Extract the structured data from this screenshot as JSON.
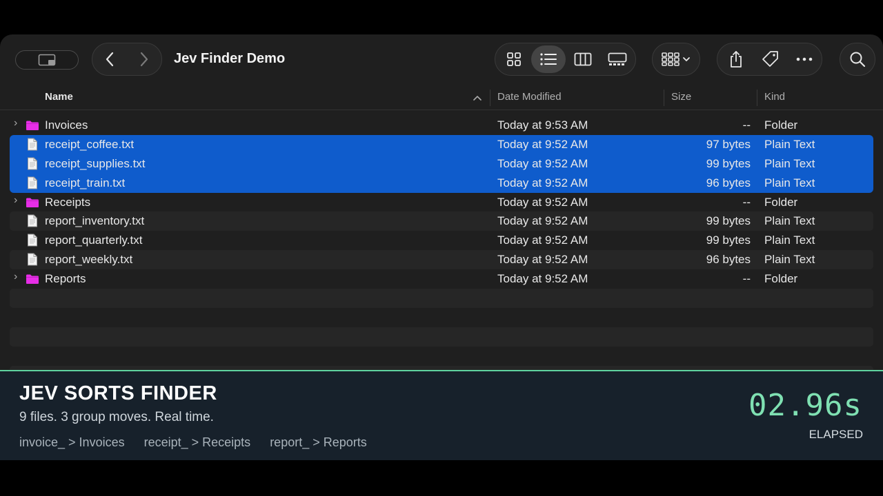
{
  "window": {
    "title": "Jev Finder Demo"
  },
  "columns": {
    "name": "Name",
    "date": "Date Modified",
    "size": "Size",
    "kind": "Kind"
  },
  "files": [
    {
      "name": "Invoices",
      "date": "Today at 9:53 AM",
      "size": "--",
      "kind": "Folder",
      "type": "folder",
      "selected": false
    },
    {
      "name": "receipt_coffee.txt",
      "date": "Today at 9:52 AM",
      "size": "97 bytes",
      "kind": "Plain Text",
      "type": "file",
      "selected": true
    },
    {
      "name": "receipt_supplies.txt",
      "date": "Today at 9:52 AM",
      "size": "99 bytes",
      "kind": "Plain Text",
      "type": "file",
      "selected": true
    },
    {
      "name": "receipt_train.txt",
      "date": "Today at 9:52 AM",
      "size": "96 bytes",
      "kind": "Plain Text",
      "type": "file",
      "selected": true
    },
    {
      "name": "Receipts",
      "date": "Today at 9:52 AM",
      "size": "--",
      "kind": "Folder",
      "type": "folder",
      "selected": false
    },
    {
      "name": "report_inventory.txt",
      "date": "Today at 9:52 AM",
      "size": "99 bytes",
      "kind": "Plain Text",
      "type": "file",
      "selected": false
    },
    {
      "name": "report_quarterly.txt",
      "date": "Today at 9:52 AM",
      "size": "99 bytes",
      "kind": "Plain Text",
      "type": "file",
      "selected": false
    },
    {
      "name": "report_weekly.txt",
      "date": "Today at 9:52 AM",
      "size": "96 bytes",
      "kind": "Plain Text",
      "type": "file",
      "selected": false
    },
    {
      "name": "Reports",
      "date": "Today at 9:52 AM",
      "size": "--",
      "kind": "Folder",
      "type": "folder",
      "selected": false
    }
  ],
  "overlay": {
    "title": "JEV SORTS FINDER",
    "subtitle": "9 files. 3 group moves. Real time.",
    "rules": [
      "invoice_ > Invoices",
      "receipt_ > Receipts",
      "report_ > Reports"
    ],
    "timer": "02.96s",
    "timer_label": "ELAPSED"
  },
  "colors": {
    "selection": "#0f5ccc",
    "folder": "#e62ee6",
    "accent_green": "#7fe0b2"
  },
  "icons": [
    "sidebar-icon",
    "back-icon",
    "forward-icon",
    "grid-view-icon",
    "list-view-icon",
    "column-view-icon",
    "gallery-view-icon",
    "group-icon",
    "share-icon",
    "tag-icon",
    "more-icon",
    "search-icon",
    "folder-icon",
    "document-icon"
  ]
}
